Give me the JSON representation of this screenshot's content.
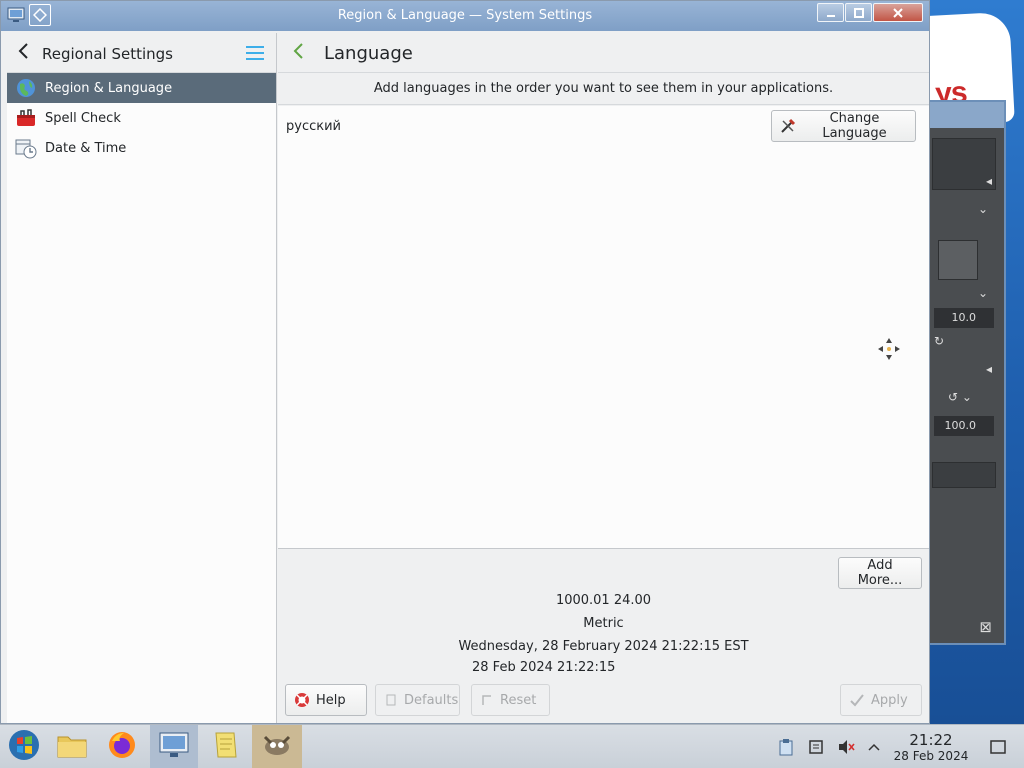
{
  "window": {
    "title": "Region & Language — System Settings"
  },
  "sidebar": {
    "title": "Regional Settings",
    "items": [
      {
        "label": "Region & Language",
        "icon": "globe-icon",
        "active": true
      },
      {
        "label": "Spell Check",
        "icon": "spell-check-icon",
        "active": false
      },
      {
        "label": "Date & Time",
        "icon": "calendar-clock-icon",
        "active": false
      }
    ]
  },
  "content": {
    "title": "Language",
    "hint": "Add languages in the order you want to see them in your applications.",
    "languages": [
      "русский"
    ],
    "change_language_label": "Change Language",
    "add_more_label": "Add More...",
    "summary": {
      "numbers": "1000.01  24.00",
      "measurement": "Metric",
      "date_long": "Wednesday, 28 February 2024 21:22:15 EST",
      "date_short": "28 Feb 2024 21:22:15"
    },
    "footer": {
      "help_label": "Help",
      "defaults_label": "Defaults",
      "reset_label": "Reset",
      "apply_label": "Apply"
    }
  },
  "background_app": {
    "field1_value": "10.0",
    "field2_value": "100.0",
    "logo_text": "ys"
  },
  "taskbar": {
    "apps": [
      "start-menu",
      "file-manager",
      "firefox",
      "system-settings",
      "notes",
      "gimp"
    ],
    "clock_time": "21:22",
    "clock_date": "28 Feb 2024"
  },
  "colors": {
    "accent": "#3daee9",
    "selection": "#5a6b7a",
    "titlebar": "#8aa7c9"
  }
}
